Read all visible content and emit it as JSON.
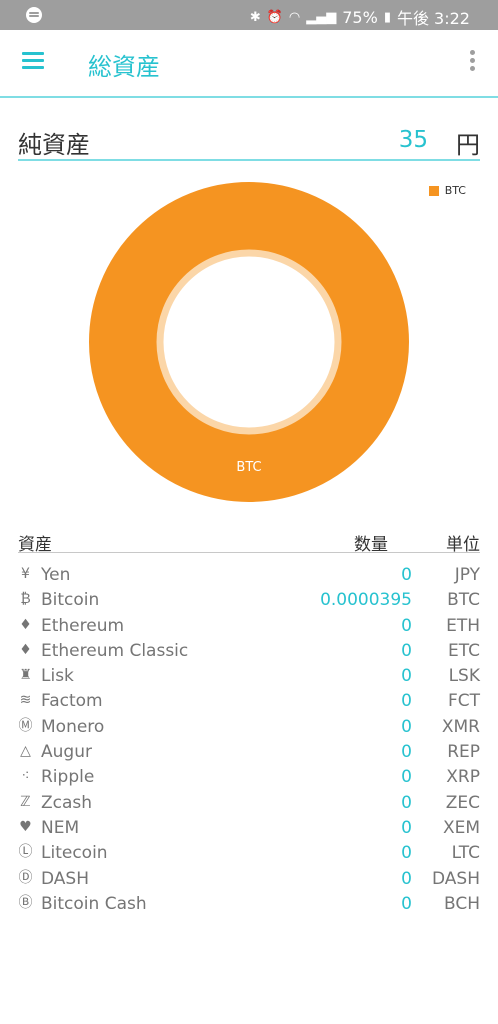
{
  "statusbar": {
    "battery": "75%",
    "time": "午後 3:22"
  },
  "appbar": {
    "title": "総資産"
  },
  "net": {
    "label": "純資産",
    "value": "35",
    "unit": "円"
  },
  "chart_data": {
    "type": "pie",
    "donut": true,
    "categories": [
      "BTC"
    ],
    "values": [
      100
    ],
    "legend": [
      "BTC"
    ],
    "legend_position": "top-right",
    "colors": [
      "#f59421"
    ]
  },
  "table": {
    "headers": {
      "asset": "資産",
      "qty": "数量",
      "unit": "単位"
    },
    "rows": [
      {
        "icon": "yen-icon",
        "name": "Yen",
        "qty": "0",
        "code": "JPY"
      },
      {
        "icon": "bitcoin-icon",
        "name": "Bitcoin",
        "qty": "0.0000395",
        "code": "BTC"
      },
      {
        "icon": "ethereum-icon",
        "name": "Ethereum",
        "qty": "0",
        "code": "ETH"
      },
      {
        "icon": "ethereum-classic-icon",
        "name": "Ethereum Classic",
        "qty": "0",
        "code": "ETC"
      },
      {
        "icon": "lisk-icon",
        "name": "Lisk",
        "qty": "0",
        "code": "LSK"
      },
      {
        "icon": "factom-icon",
        "name": "Factom",
        "qty": "0",
        "code": "FCT"
      },
      {
        "icon": "monero-icon",
        "name": "Monero",
        "qty": "0",
        "code": "XMR"
      },
      {
        "icon": "augur-icon",
        "name": "Augur",
        "qty": "0",
        "code": "REP"
      },
      {
        "icon": "ripple-icon",
        "name": "Ripple",
        "qty": "0",
        "code": "XRP"
      },
      {
        "icon": "zcash-icon",
        "name": "Zcash",
        "qty": "0",
        "code": "ZEC"
      },
      {
        "icon": "nem-icon",
        "name": "NEM",
        "qty": "0",
        "code": "XEM"
      },
      {
        "icon": "litecoin-icon",
        "name": "Litecoin",
        "qty": "0",
        "code": "LTC"
      },
      {
        "icon": "dash-icon",
        "name": "DASH",
        "qty": "0",
        "code": "DASH"
      },
      {
        "icon": "bitcoin-cash-icon",
        "name": "Bitcoin Cash",
        "qty": "0",
        "code": "BCH"
      }
    ]
  },
  "icon_glyphs": {
    "yen-icon": "¥",
    "bitcoin-icon": "₿",
    "ethereum-icon": "♦",
    "ethereum-classic-icon": "♦",
    "lisk-icon": "♜",
    "factom-icon": "≋",
    "monero-icon": "Ⓜ",
    "augur-icon": "△",
    "ripple-icon": "⁖",
    "zcash-icon": "ℤ",
    "nem-icon": "♥",
    "litecoin-icon": "Ⓛ",
    "dash-icon": "Ⓓ",
    "bitcoin-cash-icon": "Ⓑ"
  }
}
